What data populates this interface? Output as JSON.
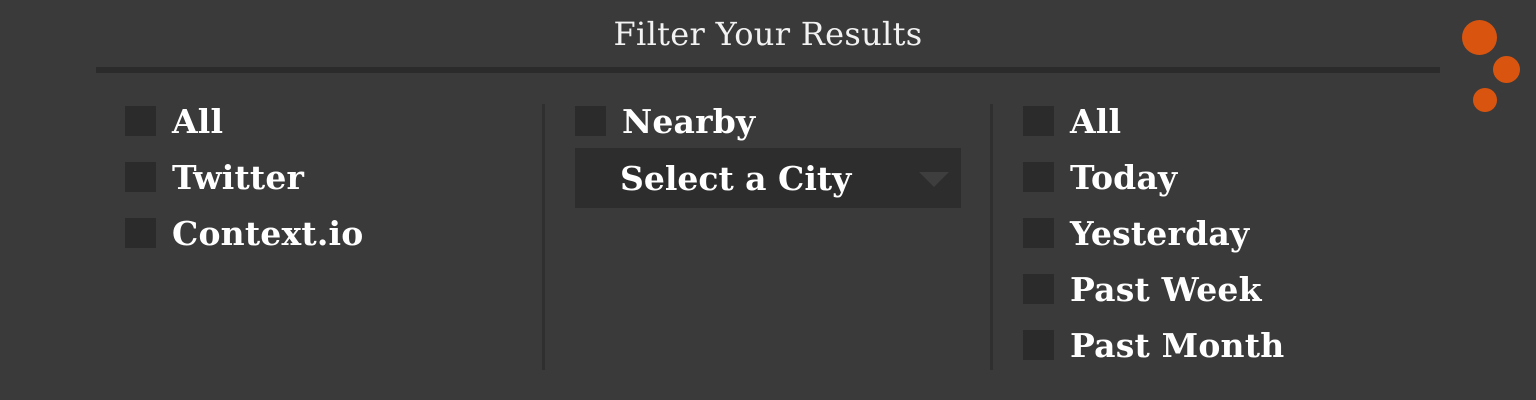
{
  "header": {
    "title": "Filter Your Results"
  },
  "sources": {
    "items": [
      {
        "label": "All"
      },
      {
        "label": "Twitter"
      },
      {
        "label": "Context.io"
      }
    ]
  },
  "location": {
    "nearby_label": "Nearby",
    "city_select": {
      "selected": "Select a City",
      "icon": "chevron-down-icon"
    }
  },
  "time_range": {
    "items": [
      {
        "label": "All"
      },
      {
        "label": "Today"
      },
      {
        "label": "Yesterday"
      },
      {
        "label": "Past Week"
      },
      {
        "label": "Past Month"
      }
    ]
  },
  "colors": {
    "background": "#3a3a3a",
    "checkbox": "#2b2b2b",
    "select_bg": "#2d2d2d",
    "accent": "#d9550f"
  },
  "logo": {
    "icon": "three-dots-logo-icon"
  }
}
